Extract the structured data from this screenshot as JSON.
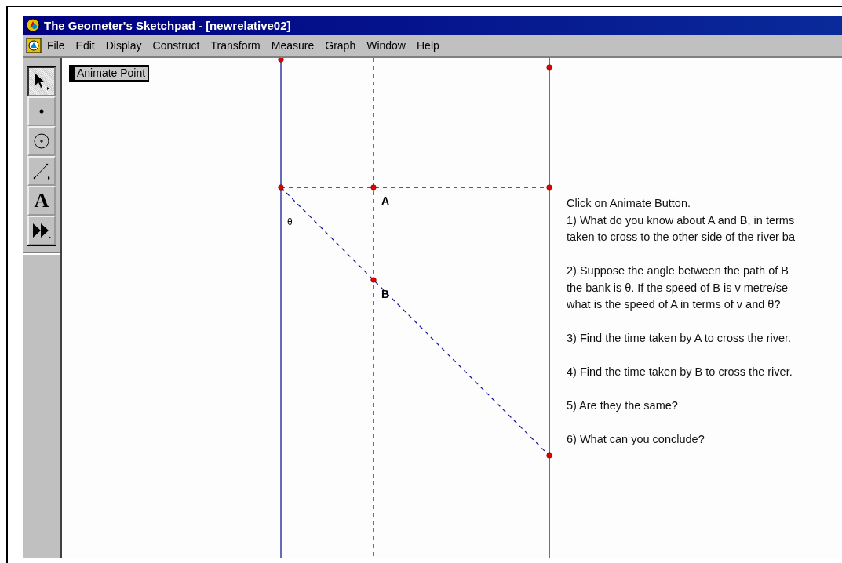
{
  "window": {
    "title": "The Geometer's Sketchpad - [newrelative02]"
  },
  "menu": [
    {
      "label": "File"
    },
    {
      "label": "Edit"
    },
    {
      "label": "Display"
    },
    {
      "label": "Construct"
    },
    {
      "label": "Transform"
    },
    {
      "label": "Measure"
    },
    {
      "label": "Graph"
    },
    {
      "label": "Window"
    },
    {
      "label": "Help"
    }
  ],
  "toolbox": [
    {
      "kind": "select",
      "selected": true
    },
    {
      "kind": "point",
      "selected": false
    },
    {
      "kind": "circle",
      "selected": false
    },
    {
      "kind": "segment",
      "selected": false
    },
    {
      "kind": "text",
      "selected": false,
      "glyph": "A"
    },
    {
      "kind": "animate",
      "selected": false
    }
  ],
  "sketch": {
    "button": "Animate Point",
    "labels": [
      {
        "kind": "point",
        "text": "A"
      },
      {
        "kind": "point",
        "text": "B"
      },
      {
        "kind": "angle",
        "text": "θ"
      }
    ],
    "instructions": [
      [
        "Click on Animate Button.",
        "1)  What do you know about A and B, in terms",
        "taken to cross to the other side of the river ba"
      ],
      [
        "2) Suppose the angle between the path of B",
        "the bank is θ. If the speed of B is v  metre/se",
        "what is the speed of A in terms of v and θ?"
      ],
      [
        "3) Find the time taken by A to cross the river."
      ],
      [
        "4) Find the time taken by B to cross the river."
      ],
      [
        "5) Are they the same?"
      ],
      [
        "6) What can you conclude?"
      ]
    ]
  }
}
